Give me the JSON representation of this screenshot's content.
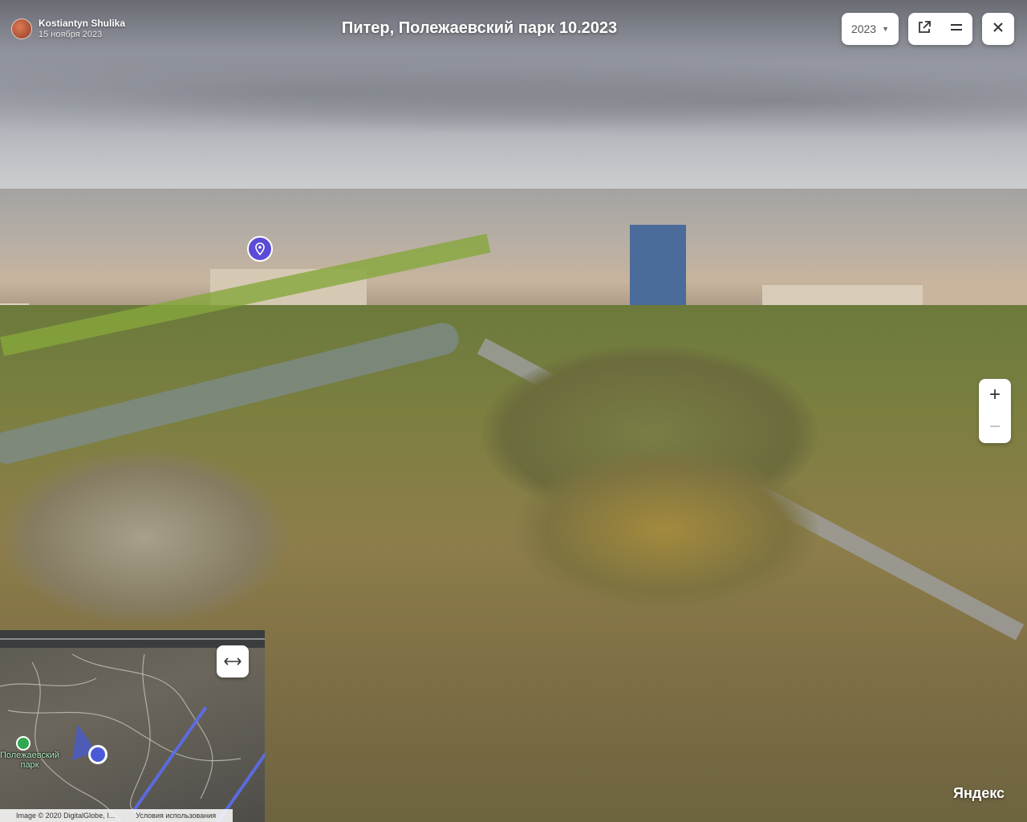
{
  "author": {
    "name": "Kostiantyn Shulika",
    "date": "15 ноября 2023"
  },
  "title": "Питер, Полежаевский парк 10.2023",
  "year_selector": {
    "value": "2023",
    "caret": "▼"
  },
  "controls": {
    "share_icon": "external-link-icon",
    "menu_icon": "menu-icon",
    "close_icon": "close-icon"
  },
  "zoom": {
    "in": "+",
    "out": "−"
  },
  "minimap": {
    "expand_icon": "expand-arrows-icon",
    "park_label": "Полежаевский парк",
    "copyright": "Image © 2020 DigitalGlobe, I...",
    "terms": "Условия использования"
  },
  "brand": "Яндекс",
  "colors": {
    "accent": "#5b4bd6",
    "minimap_route": "#5b6ef0",
    "park_icon": "#2fa84f"
  }
}
